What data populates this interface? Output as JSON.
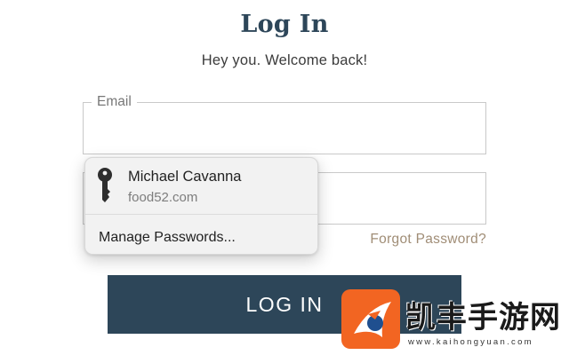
{
  "header": {
    "title": "Log In",
    "subtitle": "Hey you. Welcome back!"
  },
  "form": {
    "email_label": "Email",
    "email_value": "",
    "password_value": "",
    "forgot_link": "Forgot Password?",
    "submit_label": "LOG IN"
  },
  "password_popup": {
    "entry": {
      "name": "Michael Cavanna",
      "site": "food52.com",
      "icon": "key-icon"
    },
    "manage_label": "Manage Passwords..."
  },
  "watermark": {
    "title": "凯丰手游网",
    "url": "www.kaihongyuan.com"
  },
  "colors": {
    "brand_navy": "#2d4659",
    "link_tan": "#a08d76",
    "watermark_orange": "#f26522"
  }
}
